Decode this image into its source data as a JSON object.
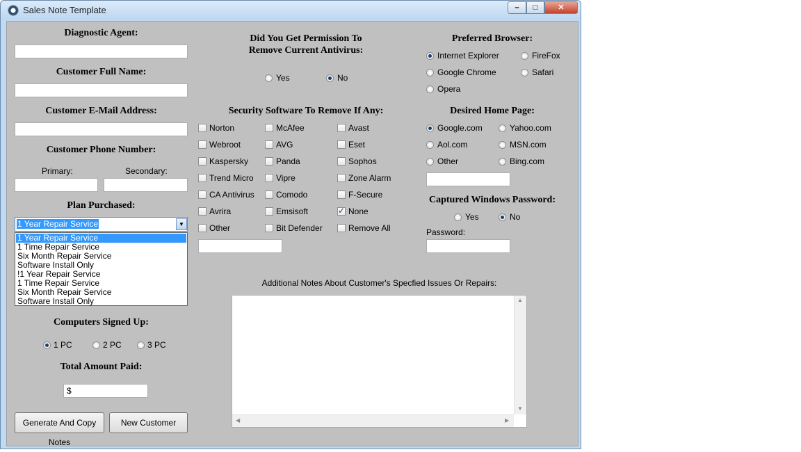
{
  "window": {
    "title": "Sales Note Template"
  },
  "left": {
    "diagnostic_agent_label": "Diagnostic Agent:",
    "customer_name_label": "Customer Full Name:",
    "customer_email_label": "Customer E-Mail Address:",
    "customer_phone_label": "Customer Phone Number:",
    "primary_label": "Primary:",
    "secondary_label": "Secondary:",
    "plan_label": "Plan Purchased:",
    "plan_selected": "1 Year Repair Service",
    "plan_options": [
      "1 Year Repair Service",
      "1 Time Repair Service",
      "Six Month Repair Service",
      "Software Install Only",
      "!1 Year Repair Service",
      "1 Time Repair Service",
      "Six Month Repair Service",
      "Software Install Only"
    ],
    "computers_label": "Computers Signed Up:",
    "pc_options": [
      "1 PC",
      "2 PC",
      "3 PC"
    ],
    "total_label": "Total Amount Paid:",
    "total_value": "$",
    "generate_button": "Generate And Copy Notes",
    "new_customer_button": "New Customer"
  },
  "middle": {
    "permission_label_line1": "Did You Get Permission To",
    "permission_label_line2": "Remove Current Antivirus:",
    "permission_yes": "Yes",
    "permission_no": "No",
    "security_label": "Security Software To Remove If Any:",
    "software": [
      [
        "Norton",
        "McAfee",
        "Avast"
      ],
      [
        "Webroot",
        "AVG",
        "Eset"
      ],
      [
        "Kaspersky",
        "Panda",
        "Sophos"
      ],
      [
        "Trend Micro",
        "Vipre",
        "Zone Alarm"
      ],
      [
        "CA Antivirus",
        "Comodo",
        "F-Secure"
      ],
      [
        "Avrira",
        "Emsisoft",
        "None"
      ],
      [
        "Other",
        "Bit Defender",
        "Remove All"
      ]
    ],
    "notes_label": "Additional Notes About Customer's Specfied Issues Or Repairs:"
  },
  "right": {
    "browser_label": "Preferred Browser:",
    "browsers": [
      "Internet Explorer",
      "FireFox",
      "Google Chrome",
      "Safari",
      "Opera"
    ],
    "homepage_label": "Desired Home Page:",
    "homepages": [
      "Google.com",
      "Yahoo.com",
      "Aol.com",
      "MSN.com",
      "Other",
      "Bing.com"
    ],
    "password_label": "Captured Windows Password:",
    "password_yes": "Yes",
    "password_no": "No",
    "password_field_label": "Password:"
  }
}
